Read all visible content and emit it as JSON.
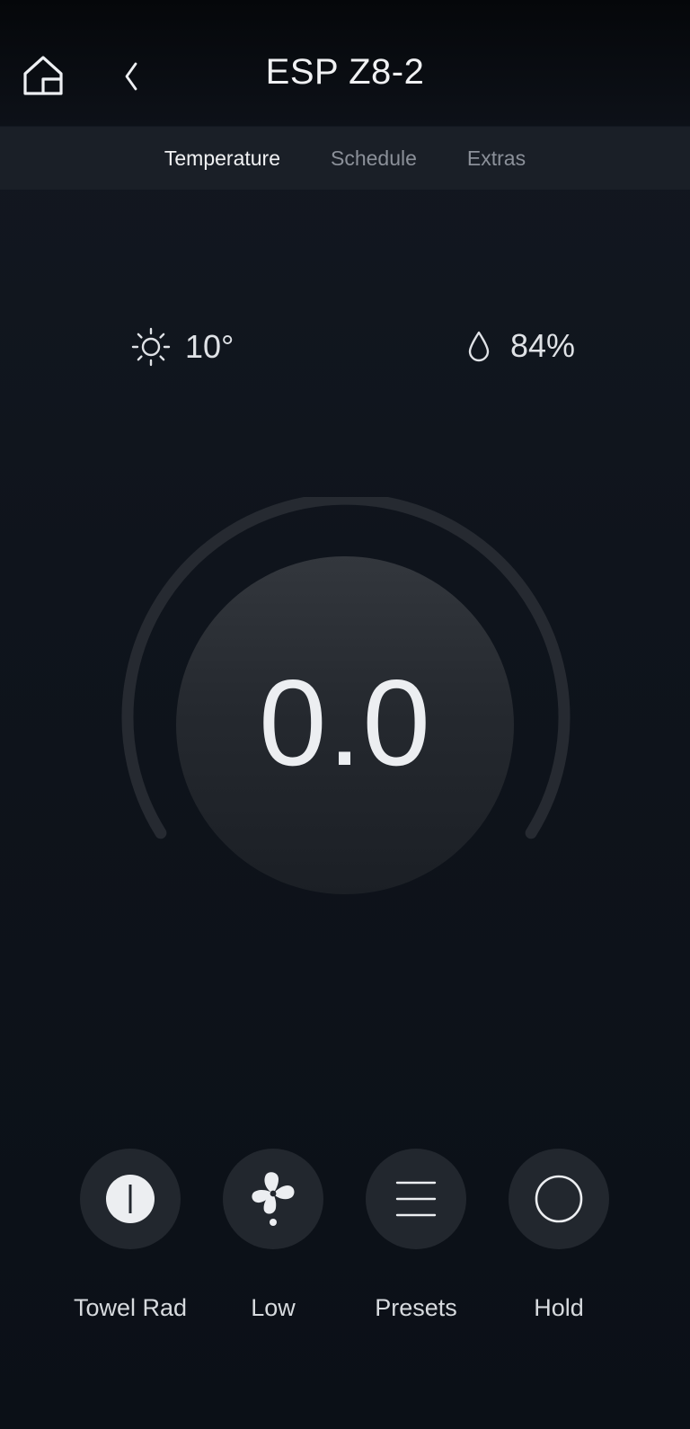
{
  "header": {
    "title": "ESP Z8-2",
    "home_icon": "home-icon",
    "back_icon": "chevron-left-icon"
  },
  "tabs": [
    {
      "label": "Temperature",
      "active": true
    },
    {
      "label": "Schedule",
      "active": false
    },
    {
      "label": "Extras",
      "active": false
    }
  ],
  "weather": {
    "outdoor_temp": "10°",
    "outdoor_icon": "sun-icon",
    "humidity": "84%",
    "humidity_icon": "droplet-icon"
  },
  "thermostat": {
    "value": "0.0"
  },
  "controls": [
    {
      "label": "Towel Rad",
      "icon": "power-icon"
    },
    {
      "label": "Low",
      "icon": "fan-icon"
    },
    {
      "label": "Presets",
      "icon": "menu-lines-icon"
    },
    {
      "label": "Hold",
      "icon": "circle-icon"
    }
  ],
  "colors": {
    "background": "#0f141c",
    "tab_bar": "#1a1f27",
    "button": "#22272e",
    "text": "#e6e8ec",
    "muted_text": "#8b9099"
  }
}
